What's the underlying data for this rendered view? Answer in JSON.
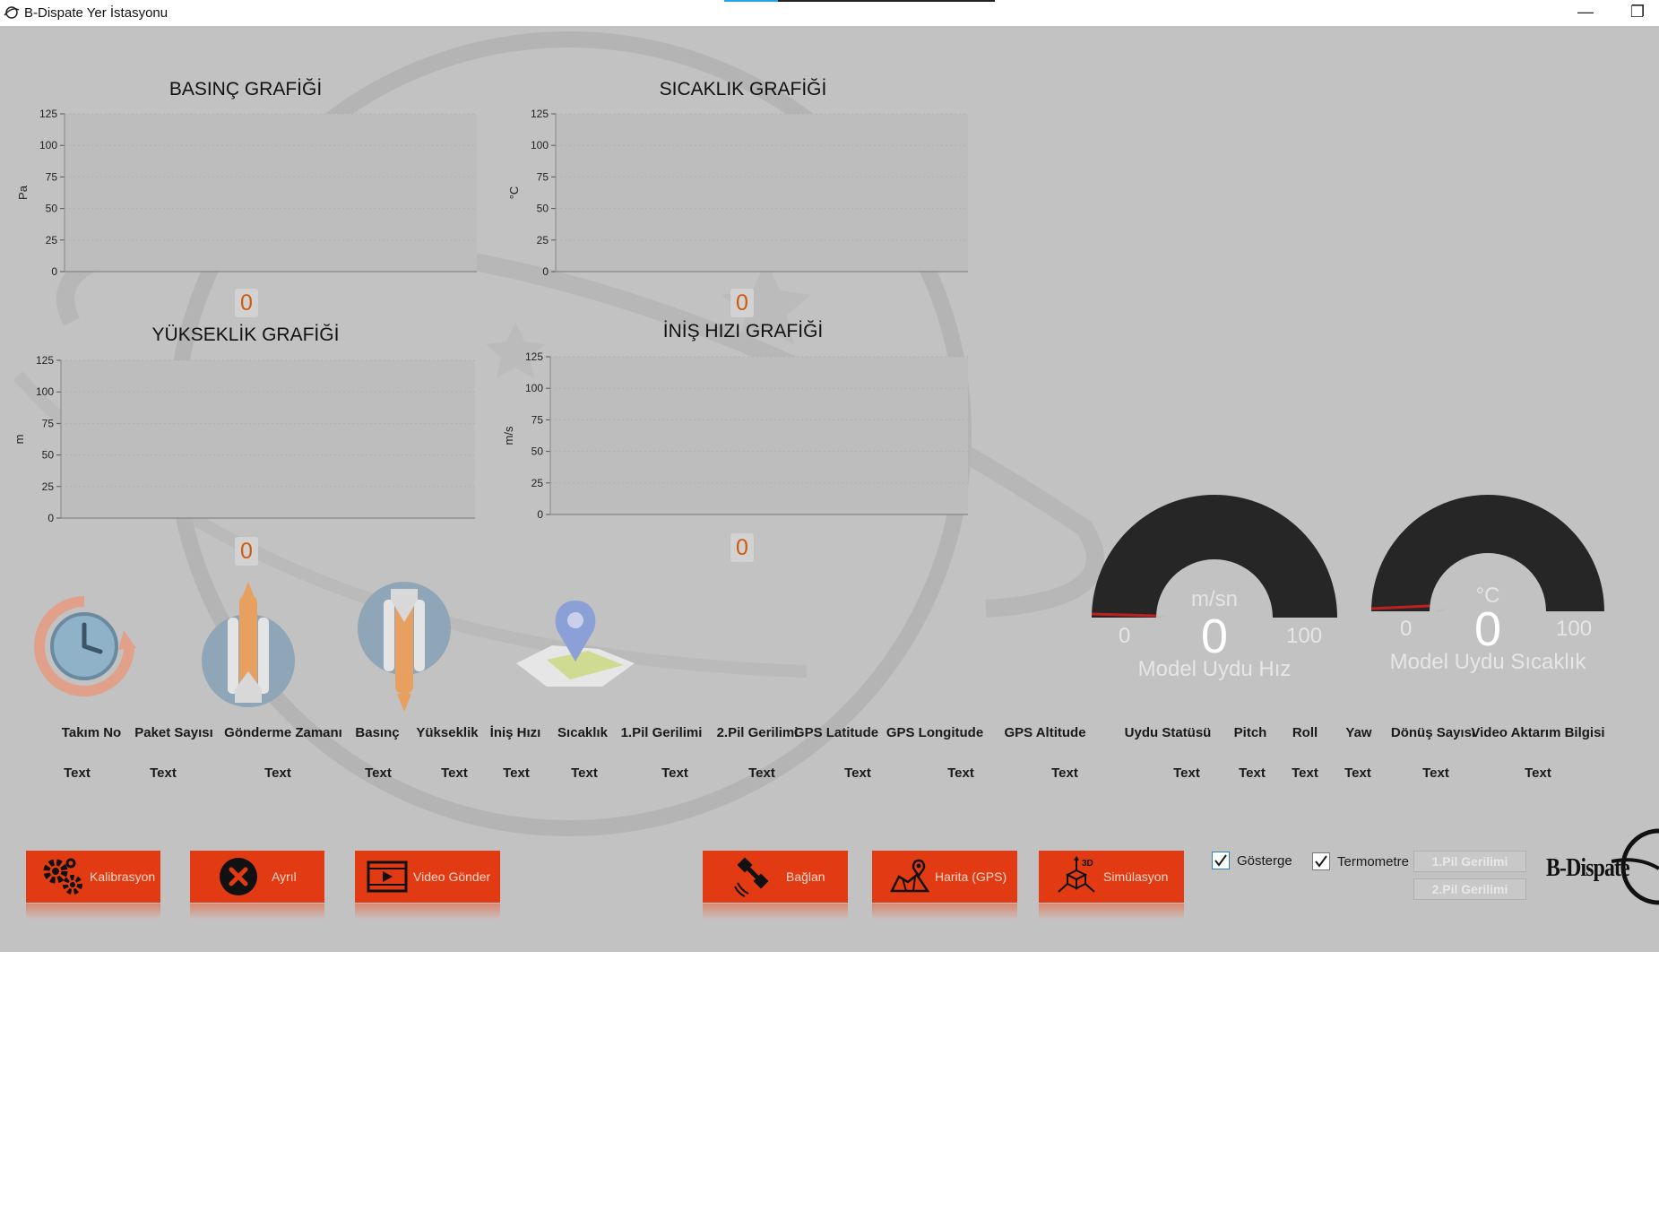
{
  "window": {
    "title": "B-Dispate Yer İstasyonu",
    "minimize_glyph": "—",
    "restore_glyph": "❐"
  },
  "charts": [
    {
      "id": "basinc",
      "title": "BASINÇ GRAFİĞİ",
      "ylabel": "Pa",
      "ticks": [
        "125",
        "100",
        "75",
        "50",
        "25",
        "0"
      ],
      "reading": "0"
    },
    {
      "id": "sicaklik",
      "title": "SICAKLIK GRAFİĞİ",
      "ylabel": "°C",
      "ticks": [
        "125",
        "100",
        "75",
        "50",
        "25",
        "0"
      ],
      "reading": "0"
    },
    {
      "id": "yukseklik",
      "title": "YÜKSEKLİK GRAFİĞİ",
      "ylabel": "m",
      "ticks": [
        "125",
        "100",
        "75",
        "50",
        "25",
        "0"
      ],
      "reading": "0"
    },
    {
      "id": "inis",
      "title": "İNİŞ HIZI GRAFİĞİ",
      "ylabel": "m/s",
      "ticks": [
        "125",
        "100",
        "75",
        "50",
        "25",
        "0"
      ],
      "reading": "0"
    }
  ],
  "chart_data": [
    {
      "type": "line",
      "title": "BASINÇ GRAFİĞİ",
      "ylabel": "Pa",
      "xlabel": "",
      "ylim": [
        0,
        125
      ],
      "series": [
        {
          "values": []
        }
      ]
    },
    {
      "type": "line",
      "title": "SICAKLIK GRAFİĞİ",
      "ylabel": "°C",
      "xlabel": "",
      "ylim": [
        0,
        125
      ],
      "series": [
        {
          "values": []
        }
      ]
    },
    {
      "type": "line",
      "title": "YÜKSEKLİK GRAFİĞİ",
      "ylabel": "m",
      "xlabel": "",
      "ylim": [
        0,
        125
      ],
      "series": [
        {
          "values": []
        }
      ]
    },
    {
      "type": "line",
      "title": "İNİŞ HIZI GRAFİĞİ",
      "ylabel": "m/s",
      "xlabel": "",
      "ylim": [
        0,
        125
      ],
      "series": [
        {
          "values": []
        }
      ]
    }
  ],
  "gauges": [
    {
      "label": "Model Uydu Hız",
      "unit": "m/sn",
      "value": "0",
      "min": "0",
      "max": "100",
      "fraction": 0
    },
    {
      "label": "Model Uydu Sıcaklık",
      "unit": "°C",
      "value": "0",
      "min": "0",
      "max": "100",
      "fraction": 0
    }
  ],
  "icons": [
    "clock-icon",
    "shuttle-launch-icon",
    "shuttle-landing-icon",
    "map-pin-icon"
  ],
  "telemetry": {
    "columns": [
      "Takım No",
      "Paket Sayısı",
      "Gönderme Zamanı",
      "Basınç",
      "Yükseklik",
      "İniş Hızı",
      "Sıcaklık",
      "1.Pil Gerilimi",
      "2.Pil Gerilimi",
      "GPS Latitude",
      "GPS Longitude",
      "GPS Altitude",
      "Uydu Statüsü",
      "Pitch",
      "Roll",
      "Yaw",
      "Dönüş Sayısı",
      "Video Aktarım Bilgisi"
    ],
    "values": [
      "Text",
      "Text",
      "Text",
      "Text",
      "Text",
      "Text",
      "Text",
      "Text",
      "Text",
      "Text",
      "Text",
      "Text",
      "Text",
      "Text",
      "Text",
      "Text",
      "Text",
      "Text"
    ]
  },
  "buttons": {
    "kalibrasyon": "Kalibrasyon",
    "ayril": "Ayrıl",
    "video_gonder": "Video Gönder",
    "baglan": "Bağlan",
    "harita": "Harita (GPS)",
    "simulasyon": "Simülasyon"
  },
  "checkboxes": {
    "gosterge": {
      "label": "Gösterge",
      "checked": true
    },
    "termometre": {
      "label": "Termometre",
      "checked": true
    }
  },
  "pil_buttons": [
    "1.Pil Gerilimi",
    "2.Pil Gerilimi"
  ],
  "brand": "B-Dispate",
  "colors": {
    "accent": "#e23a12",
    "background": "#c2c2c2",
    "gauge": "#262626",
    "reading": "#d05a10"
  }
}
